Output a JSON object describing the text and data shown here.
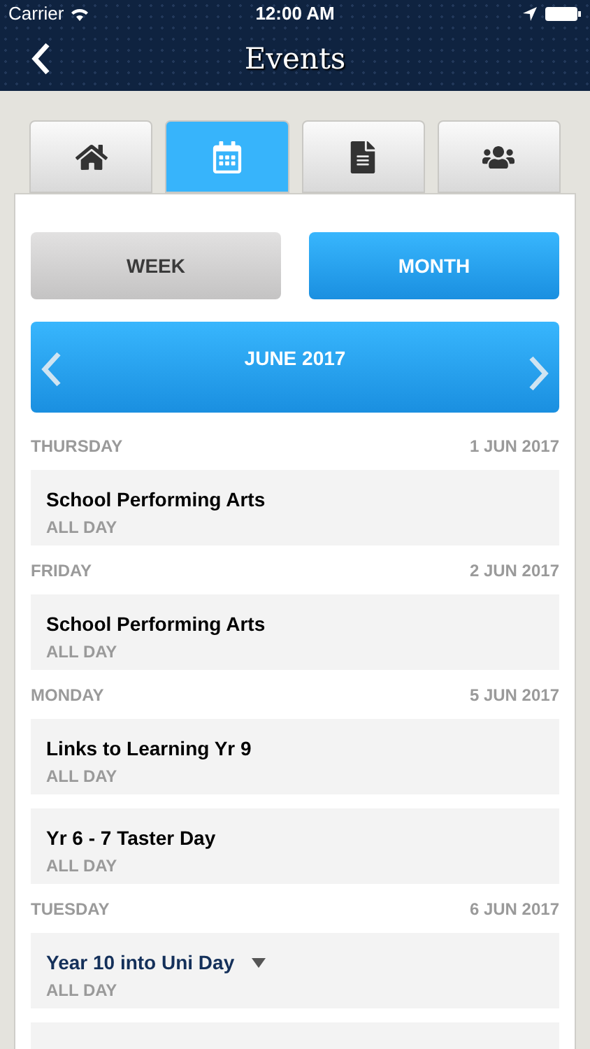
{
  "status_bar": {
    "carrier": "Carrier",
    "time": "12:00 AM"
  },
  "nav_bar": {
    "title": "Events"
  },
  "tabs": [
    {
      "selected": false
    },
    {
      "selected": true
    },
    {
      "selected": false
    },
    {
      "selected": false
    }
  ],
  "view_toggle": [
    {
      "label": "WEEK",
      "selected": false
    },
    {
      "label": "MONTH",
      "selected": true
    }
  ],
  "month_header": {
    "label": "JUNE 2017"
  },
  "days": [
    {
      "weekday": "THURSDAY",
      "date": "1 JUN 2017",
      "events": [
        {
          "title": "School Performing Arts",
          "time": "ALL DAY",
          "has_details": false
        }
      ]
    },
    {
      "weekday": "FRIDAY",
      "date": "2 JUN 2017",
      "events": [
        {
          "title": "School Performing Arts",
          "time": "ALL DAY",
          "has_details": false
        }
      ]
    },
    {
      "weekday": "MONDAY",
      "date": "5 JUN 2017",
      "events": [
        {
          "title": "Links to Learning Yr 9",
          "time": "ALL DAY",
          "has_details": false
        },
        {
          "title": "Yr 6 - 7 Taster Day",
          "time": "ALL DAY",
          "has_details": false
        }
      ]
    },
    {
      "weekday": "TUESDAY",
      "date": "6 JUN 2017",
      "events": [
        {
          "title": "Year 10 into Uni Day",
          "time": "ALL DAY",
          "has_details": true
        },
        {
          "has_details": false
        }
      ]
    }
  ]
}
